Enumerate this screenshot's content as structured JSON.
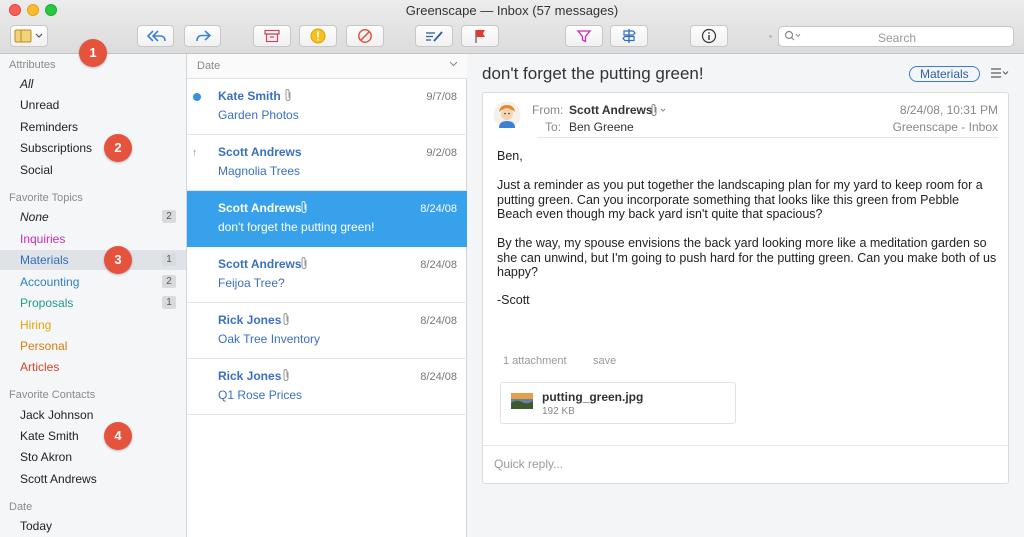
{
  "window": {
    "title": "Greenscape — Inbox (57 messages)"
  },
  "toolbar": {
    "search_placeholder": "Search",
    "buttons": [
      "sidebar-toggle",
      "reply-all",
      "forward",
      "archive",
      "flag-important",
      "block",
      "compose",
      "flag",
      "filter",
      "rules",
      "info"
    ]
  },
  "sidebar": {
    "attributes_title": "Attributes",
    "attributes": [
      {
        "label": "All",
        "italic": true
      },
      {
        "label": "Unread"
      },
      {
        "label": "Reminders"
      },
      {
        "label": "Subscriptions"
      },
      {
        "label": "Social"
      }
    ],
    "topics_title": "Favorite Topics",
    "topics": [
      {
        "label": "None",
        "italic": true,
        "count": "2",
        "color": "#222222"
      },
      {
        "label": "Inquiries",
        "color": "#c72cb4"
      },
      {
        "label": "Materials",
        "count": "1",
        "color": "#2d6ebd"
      },
      {
        "label": "Accounting",
        "count": "2",
        "color": "#2d7ec7"
      },
      {
        "label": "Proposals",
        "count": "1",
        "color": "#1f9a8e"
      },
      {
        "label": "Hiring",
        "color": "#e5a50a"
      },
      {
        "label": "Personal",
        "color": "#d97c0c"
      },
      {
        "label": "Articles",
        "color": "#d9432b"
      }
    ],
    "contacts_title": "Favorite Contacts",
    "contacts": [
      {
        "label": "Jack Johnson"
      },
      {
        "label": "Kate Smith"
      },
      {
        "label": "Sto Akron"
      },
      {
        "label": "Scott Andrews"
      }
    ],
    "date_title": "Date",
    "dates": [
      {
        "label": "Today"
      }
    ]
  },
  "callouts": [
    "1",
    "2",
    "3",
    "4"
  ],
  "message_list": {
    "sort_label": "Date",
    "messages": [
      {
        "from": "Kate Smith",
        "date": "9/7/08",
        "subject": "Garden Photos",
        "unread": true,
        "attachment": true
      },
      {
        "from": "Scott Andrews",
        "date": "9/2/08",
        "subject": "Magnolia Trees",
        "replied": true
      },
      {
        "from": "Scott Andrews",
        "date": "8/24/08",
        "subject": "don't forget the putting green!",
        "selected": true,
        "attachment": true
      },
      {
        "from": "Scott Andrews",
        "date": "8/24/08",
        "subject": "Feijoa Tree?",
        "attachment": true
      },
      {
        "from": "Rick Jones",
        "date": "8/24/08",
        "subject": "Oak Tree Inventory",
        "attachment": true
      },
      {
        "from": "Rick Jones",
        "date": "8/24/08",
        "subject": "Q1 Rose Prices",
        "attachment": true
      }
    ]
  },
  "reader": {
    "subject": "don't forget the putting green!",
    "tag": "Materials",
    "from_label": "From:",
    "from": "Scott Andrews",
    "to_label": "To:",
    "to": "Ben Greene",
    "datetime": "8/24/08, 10:31 PM",
    "mailbox": "Greenscape - Inbox",
    "body": [
      "Ben,",
      "Just a reminder as you put together the landscaping plan for my yard to keep room for a putting green. Can you incorporate something that looks like this green from Pebble Beach even though my back yard isn't quite that spacious?",
      "By the way, my spouse envisions the back yard looking more like a meditation garden so she can unwind, but I'm going to push hard for the putting green. Can you make both of us happy?",
      "-Scott"
    ],
    "attachment_count": "1 attachment",
    "save_label": "save",
    "attachment": {
      "name": "putting_green.jpg",
      "size": "192 KB"
    },
    "reply_placeholder": "Quick reply..."
  }
}
